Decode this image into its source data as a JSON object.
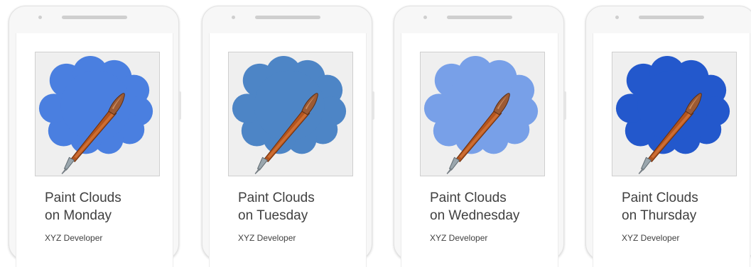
{
  "icons": {
    "cloud": "cloud-icon",
    "brush": "paintbrush-icon"
  },
  "apps": [
    {
      "title_line1": "Paint Clouds",
      "title_line2": "on Monday",
      "developer": "XYZ Developer",
      "cloud_color": "#4a7fe0"
    },
    {
      "title_line1": "Paint Clouds",
      "title_line2": "on Tuesday",
      "developer": "XYZ Developer",
      "cloud_color": "#4d85c6"
    },
    {
      "title_line1": "Paint Clouds",
      "title_line2": "on Wednesday",
      "developer": "XYZ Developer",
      "cloud_color": "#78a0e8"
    },
    {
      "title_line1": "Paint Clouds",
      "title_line2": "on Thursday",
      "developer": "XYZ Developer",
      "cloud_color": "#2358cc"
    }
  ]
}
